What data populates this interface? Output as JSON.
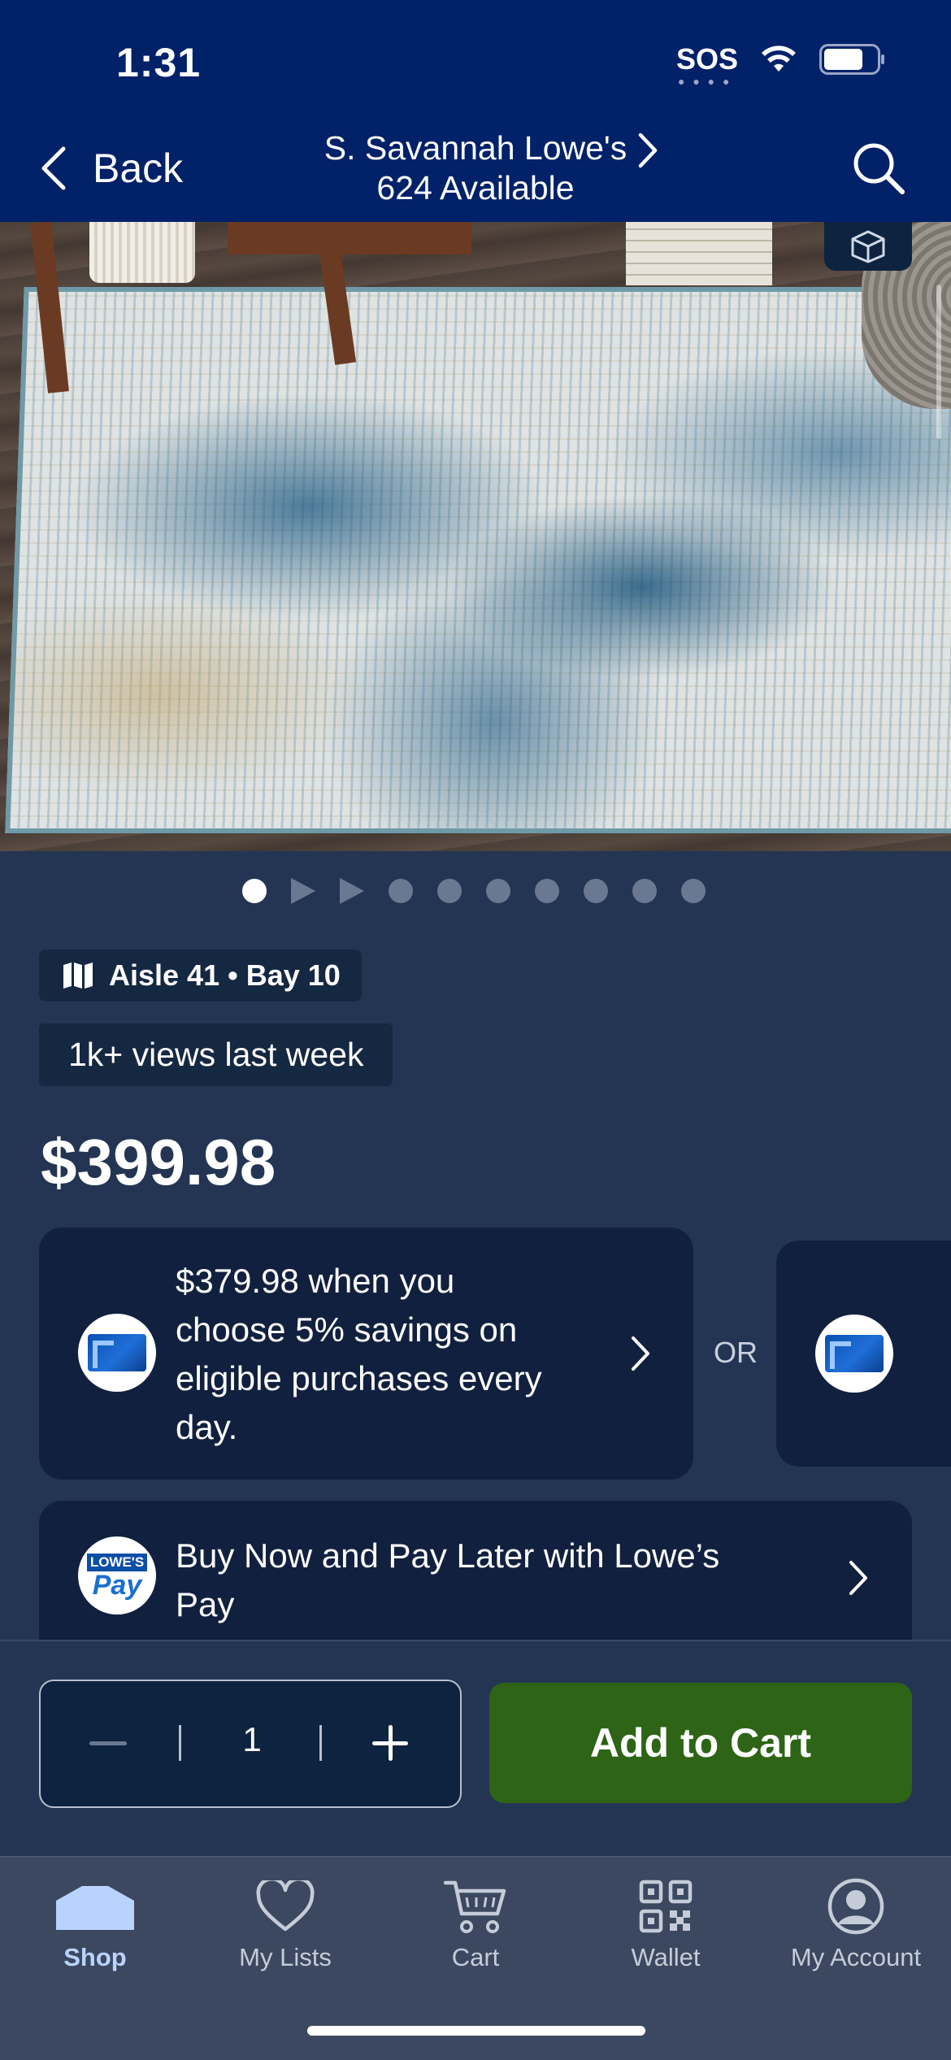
{
  "status_bar": {
    "time": "1:31",
    "carrier": "SOS",
    "battery_level": 0.75
  },
  "nav": {
    "back_label": "Back",
    "store_name": "S. Savannah Lowe's",
    "availability": "624 Available"
  },
  "gallery": {
    "slide_count": 10,
    "active_index": 0,
    "video_slides": [
      1,
      2
    ]
  },
  "product": {
    "location": "Aisle 41 • Bay 10",
    "views": "1k+ views last week",
    "price": "$399.98"
  },
  "offers": {
    "card_offer": "$379.98 when you choose 5% savings on eligible purchases every day.",
    "or_label": "OR",
    "pay_later": "Buy Now and Pay Later with Lowe’s Pay",
    "pay_logo_top": "LOWE'S",
    "pay_logo_bottom": "Pay"
  },
  "cart": {
    "quantity": "1",
    "add_label": "Add to Cart"
  },
  "tabs": [
    {
      "label": "Shop",
      "icon": "shop-icon",
      "active": true
    },
    {
      "label": "My Lists",
      "icon": "heart-icon",
      "active": false
    },
    {
      "label": "Cart",
      "icon": "cart-icon",
      "active": false
    },
    {
      "label": "Wallet",
      "icon": "qr-code-icon",
      "active": false
    },
    {
      "label": "My Account",
      "icon": "account-icon",
      "active": false
    }
  ],
  "colors": {
    "header_bg": "#012169",
    "page_bg": "#243553",
    "card_bg": "#11203f",
    "cta_green": "#2d6416",
    "tab_active": "#b9d3ff"
  }
}
